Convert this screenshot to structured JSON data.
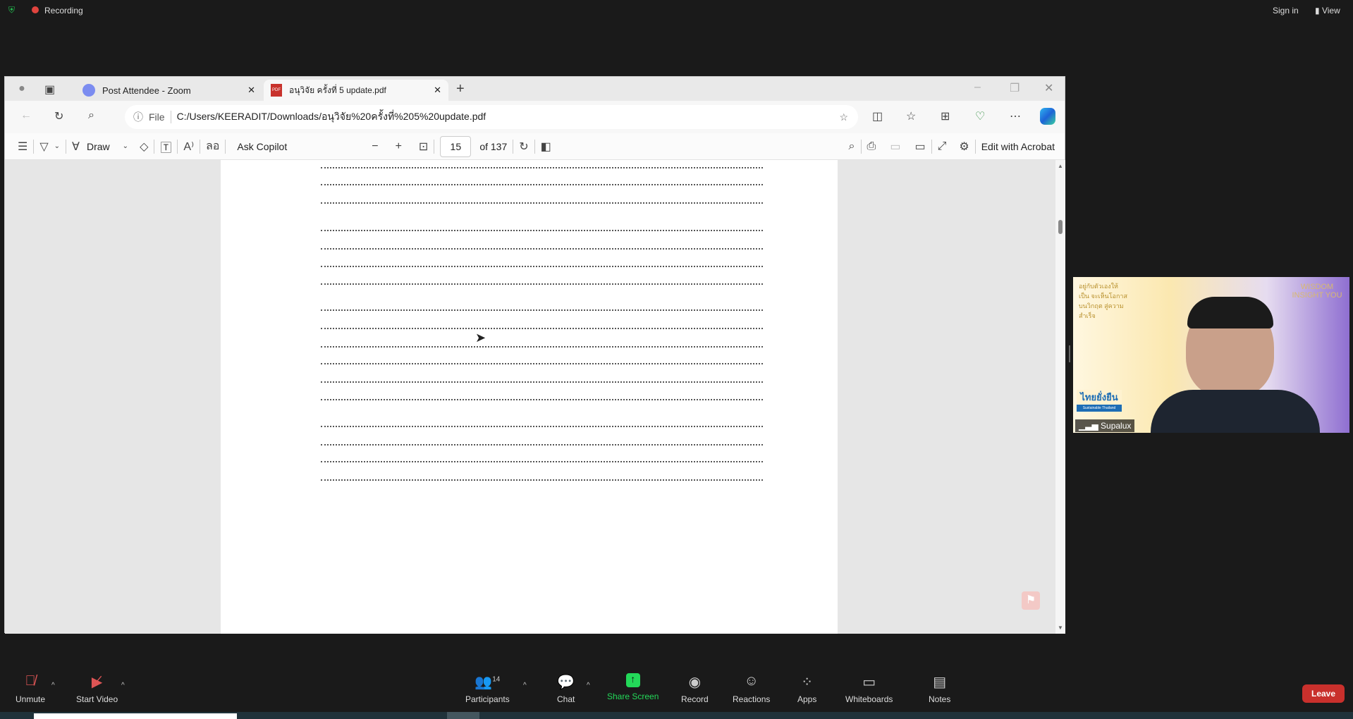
{
  "topbar": {
    "recording": "Recording",
    "sign_in": "Sign in",
    "view": "View"
  },
  "browser": {
    "tabs": [
      {
        "title": "Post Attendee - Zoom"
      },
      {
        "title": "อนุวิจัย ครั้งที่ 5 update.pdf"
      }
    ],
    "url_prefix": "File",
    "url": "C:/Users/KEERADIT/Downloads/อนุวิจัย%20ครั้งที่%205%20update.pdf"
  },
  "pdf_toolbar": {
    "draw": "Draw",
    "ask_copilot": "Ask Copilot",
    "page": "15",
    "of_pages": "of 137",
    "edit_acrobat": "Edit with Acrobat"
  },
  "video": {
    "participant": "Supalux",
    "bg_text_left": "อยู่กับตัวเองให้เป็น จะเห็นโอกาสบนวิกฤต สู่ความสำเร็จ",
    "logo_left": "ไทยยั่งยืน",
    "logo_left_sub": "Sustainable Thailand",
    "logo_right": "WISDOM INSIGHT YOU"
  },
  "zoom_toolbar": {
    "unmute": "Unmute",
    "start_video": "Start Video",
    "participants": "Participants",
    "participants_count": "14",
    "chat": "Chat",
    "share_screen": "Share Screen",
    "record": "Record",
    "reactions": "Reactions",
    "apps": "Apps",
    "whiteboards": "Whiteboards",
    "notes": "Notes",
    "leave": "Leave"
  },
  "colors": {
    "share_green": "#23d959",
    "leave_red": "#c9302c",
    "record_red": "#e0443e"
  }
}
